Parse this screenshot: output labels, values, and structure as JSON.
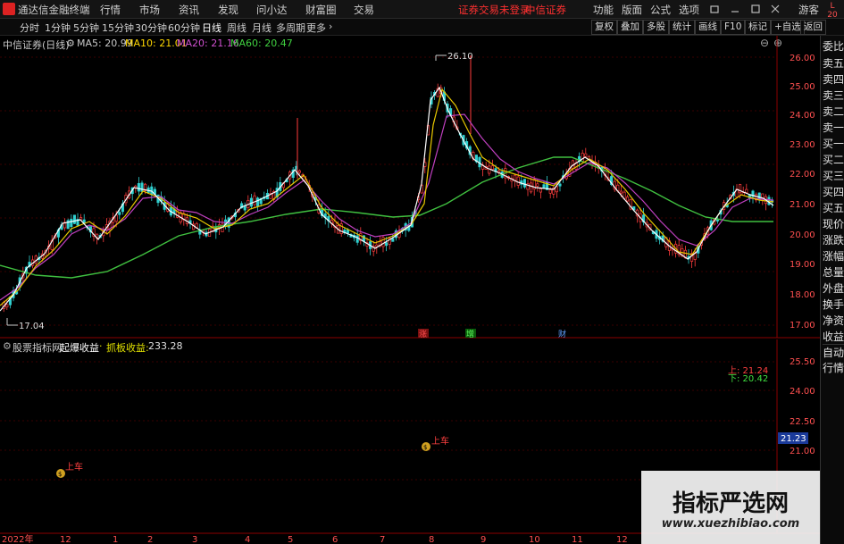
{
  "menubar": {
    "app_title": "通达信金融终端",
    "items": [
      "行情",
      "市场",
      "资讯",
      "发现",
      "问小达",
      "财富圈",
      "交易"
    ],
    "warning": "证券交易未登录",
    "broker": "中信证券",
    "right_items": [
      "功能",
      "版面",
      "公式",
      "选项"
    ],
    "guest": "游客"
  },
  "periodbar": {
    "items": [
      "分时",
      "1分钟",
      "5分钟",
      "15分钟",
      "30分钟",
      "60分钟",
      "日线",
      "周线",
      "月线",
      "多周期",
      "更多"
    ],
    "active": "日线",
    "buttons": [
      "复权",
      "叠加",
      "多股",
      "统计",
      "画线",
      "F10",
      "标记",
      "+自选",
      "返回"
    ]
  },
  "main_chart": {
    "stock_title": "中信证券(日线)",
    "ma": [
      {
        "label": "MA5: 20.99",
        "color": "#ffffff"
      },
      {
        "label": "MA10: 21.01",
        "color": "#ffd700"
      },
      {
        "label": "MA20: 21.16",
        "color": "#d050d0"
      },
      {
        "label": "MA60: 20.47",
        "color": "#40d040"
      }
    ],
    "yticks": [
      "26.00",
      "25.00",
      "24.00",
      "23.00",
      "22.00",
      "21.00",
      "20.00",
      "19.00",
      "18.00",
      "17.00"
    ],
    "high_label": "26.10",
    "low_label": "17.04",
    "markers": [
      "涨",
      "增",
      "财"
    ]
  },
  "sub_chart": {
    "title": "股票指标网",
    "name": "起爆收益",
    "sep": "·",
    "name2": "抓板收益:",
    "value": "233.28",
    "yticks": [
      "25.50",
      "24.00",
      "22.50",
      "21.00"
    ],
    "up_label": "上: 21.24",
    "down_label": "下: 20.42",
    "current_price": "21.23",
    "signals": [
      "上车",
      "上车"
    ]
  },
  "xaxis": [
    "2022年",
    "12",
    "1",
    "2",
    "3",
    "4",
    "5",
    "6",
    "7",
    "8",
    "9",
    "10",
    "11",
    "12"
  ],
  "sidebar": {
    "top": "L\n20",
    "items": [
      "委比",
      "卖五",
      "卖四",
      "卖三",
      "卖二",
      "卖一",
      "买一",
      "买二",
      "买三",
      "买四",
      "买五",
      "现价",
      "涨跌",
      "涨幅",
      "总量",
      "外盘",
      "换手",
      "净资",
      "收益",
      "自动",
      "行情"
    ]
  },
  "watermark": {
    "title": "指标严选网",
    "url": "www.xuezhibiao.com"
  }
}
